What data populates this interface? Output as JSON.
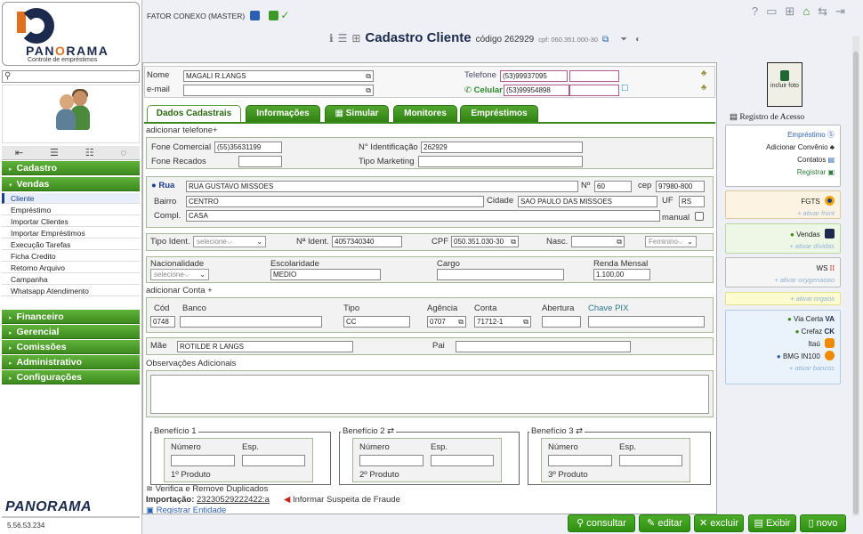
{
  "brand": {
    "logo_name_a": "PAN",
    "logo_name_o": "O",
    "logo_name_b": "RAMA",
    "logo_tagline": "Controle de empréstimos",
    "sidebar_brand": "PANORAMA",
    "version": "5.56.53.234"
  },
  "topbar": {
    "master_label": "FATOR CONEXO (MASTER)",
    "check_symbol": "✓"
  },
  "title": {
    "text": "Cadastro Cliente",
    "code": "código 262929",
    "cpf": "cpf: 060.351.000-30"
  },
  "sidebar": {
    "menu": [
      {
        "label": "Cadastro"
      },
      {
        "label": "Vendas"
      },
      {
        "label": "Financeiro"
      },
      {
        "label": "Gerencial"
      },
      {
        "label": "Comissões"
      },
      {
        "label": "Administrativo"
      },
      {
        "label": "Configurações"
      }
    ],
    "vendas_items": [
      "Cliente",
      "Empréstimo",
      "Importar Clientes",
      "Importar Empréstimos",
      "Execução Tarefas",
      "Ficha Credito",
      "Retorno Arquivo",
      "Campanha",
      "Whatsapp Atendimento"
    ]
  },
  "header_fields": {
    "nome_label": "Nome",
    "nome_value": "MAGALI  R.LANGS",
    "email_label": "e-mail",
    "email_value": "",
    "telefone_label": "Telefone",
    "telefone_value": "(53)99937095",
    "celular_label": "Celular",
    "celular_value": "(53)99954898"
  },
  "tabs": [
    "Dados Cadastrais",
    "Informações",
    "Simular",
    "Monitores",
    "Empréstimos"
  ],
  "form": {
    "add_phone": "adicionar telefone+",
    "fone_comercial_label": "Fone Comercial",
    "fone_comercial_value": "(55)35631199",
    "fone_recados_label": "Fone Recados",
    "fone_recados_value": "",
    "n_ident_label": "N° Identificação",
    "n_ident_value": "262929",
    "tipo_marketing_label": "Tipo Marketing",
    "rua_label": "Rua",
    "rua_value": "RUA GUSTAVO MISSOES",
    "numero_label": "Nº",
    "numero_value": "60",
    "cep_label": "cep",
    "cep_value": "97980-800",
    "bairro_label": "Bairro",
    "bairro_value": "CENTRO",
    "cidade_label": "Cidade",
    "cidade_value": "SAO PAULO DAS MISSOES",
    "uf_label": "UF",
    "uf_value": "RS",
    "compl_label": "Compl.",
    "compl_value": "CASA",
    "manual_label": "manual",
    "tipo_ident_label": "Tipo Ident.",
    "tipo_ident_value": "selecione",
    "n_ident2_label": "Nª Ident.",
    "n_ident2_value": "4057340340",
    "cpf_label": "CPF",
    "cpf_value": "050.351.030-30",
    "nasc_label": "Nasc.",
    "nasc_value": "",
    "sexo_value": "Feminino",
    "nacionalidade_label": "Nacionalidade",
    "nacionalidade_value": "selecione",
    "escolaridade_label": "Escolaridade",
    "escolaridade_value": "MEDIO",
    "cargo_label": "Cargo",
    "cargo_value": "",
    "renda_label": "Renda Mensal",
    "renda_value": "1.100,00",
    "add_conta": "adicionar Conta +",
    "cod_label": "Cód",
    "cod_value": "0748",
    "banco_label": "Banco",
    "banco_value": "",
    "tipo_label": "Tipo",
    "tipo_value": "CC",
    "agencia_label": "Agência",
    "agencia_value": "0707",
    "conta_label": "Conta",
    "conta_value": "71712-1",
    "abertura_label": "Abertura",
    "abertura_value": "",
    "pix_label": "Chave PIX",
    "pix_value": "",
    "mae_label": "Mãe",
    "mae_value": "ROTILDE R LANGS",
    "pai_label": "Pai",
    "pai_value": "",
    "obs_label": "Observações Adicionais"
  },
  "beneficios": [
    {
      "title": "Benefício 1",
      "numero_label": "Número",
      "esp_label": "Esp.",
      "produto": "1º Produto"
    },
    {
      "title": "Benefício 2 ⇄",
      "numero_label": "Número",
      "esp_label": "Esp.",
      "produto": "2º Produto"
    },
    {
      "title": "Benefício 3 ⇄",
      "numero_label": "Número",
      "esp_label": "Esp.",
      "produto": "3º Produto"
    }
  ],
  "footer_links": {
    "verifica": "Verifica e Remove Duplicados",
    "importacao_label": "Importação:",
    "importacao_value": "23230529222422:a",
    "fraude": "Informar Suspeita de Fraude",
    "registrar": "Registrar Entidade"
  },
  "buttons": {
    "consultar": "consultar",
    "editar": "editar",
    "excluir": "excluir",
    "exibir": "Exibir",
    "novo": "novo"
  },
  "right_panel": {
    "photo_label": "incluir foto",
    "registro": "Registro de Acesso",
    "links": [
      "Empréstimo",
      "Adicionar Convênio",
      "Contatos",
      "Registrar"
    ],
    "fgts": "FGTS",
    "fgts_action": "+ ativar front",
    "vendas": "Vendas",
    "vendas_action": "+ ativar dívidas",
    "ws": "WS",
    "ws_action": "+ ativar oxygenaoao",
    "orgaos_action": "+ ativar orgaos",
    "banks": [
      "Via Certa",
      "Crefaz",
      "Itaú",
      "BMG IN100"
    ],
    "banks_action": "+ ativar bancos"
  },
  "colors": {
    "menu_green": "#3d8a1e",
    "brand_navy": "#1c2a4e",
    "brand_orange": "#e07020"
  }
}
